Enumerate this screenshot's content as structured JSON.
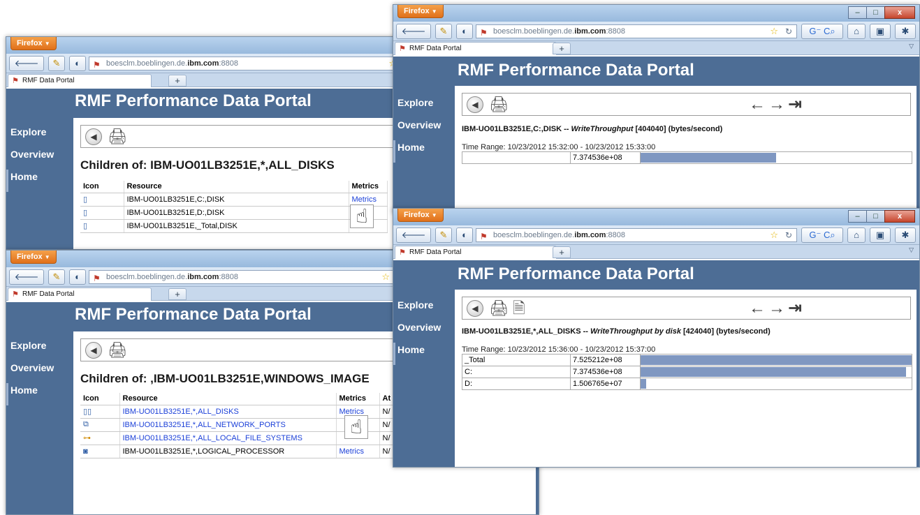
{
  "browser": {
    "menu_label": "Firefox",
    "url_host": "boesclm.boeblingen.de.",
    "url_domain": "ibm.com",
    "url_port": ":8808",
    "tab_label": "RMF Data Portal",
    "new_tab_label": "+",
    "window_controls": {
      "minimize": "–",
      "maximize": "□",
      "close": "x"
    }
  },
  "portal": {
    "title": "RMF Performance Data Portal",
    "nav": {
      "explore": "Explore",
      "overview": "Overview",
      "home": "Home"
    }
  },
  "icons": {
    "back": "back-icon",
    "print": "printer-icon",
    "export": "export-document-icon",
    "nav_arrows": "←→⇥",
    "hand_cursor": "hand-pointer-icon"
  },
  "disks_window": {
    "heading": "Children of: IBM-UO01LB3251E,*,ALL_DISKS",
    "columns": [
      "Icon",
      "Resource",
      "Metrics"
    ],
    "rows": [
      {
        "resource": "IBM-UO01LB3251E,C:,DISK",
        "metrics": "Metrics"
      },
      {
        "resource": "IBM-UO01LB3251E,D:,DISK",
        "metrics": ""
      },
      {
        "resource": "IBM-UO01LB3251E,_Total,DISK",
        "metrics": ""
      }
    ]
  },
  "image_window": {
    "heading": "Children of: ,IBM-UO01LB3251E,WINDOWS_IMAGE",
    "columns": [
      "Icon",
      "Resource",
      "Metrics",
      "At"
    ],
    "rows": [
      {
        "resource": "IBM-UO01LB3251E,*,ALL_DISKS",
        "metrics": "Metrics",
        "at": "N/"
      },
      {
        "resource": "IBM-UO01LB3251E,*,ALL_NETWORK_PORTS",
        "metrics": "",
        "at": "N/"
      },
      {
        "resource": "IBM-UO01LB3251E,*,ALL_LOCAL_FILE_SYSTEMS",
        "metrics": "",
        "at": "N/"
      },
      {
        "resource": "IBM-UO01LB3251E,*,LOGICAL_PROCESSOR",
        "metrics": "Metrics",
        "at": "N/"
      }
    ]
  },
  "metric_c_window": {
    "title_prefix": "IBM-UO01LB3251E,C:,DISK -- ",
    "metric_name": "WriteThroughput",
    "title_suffix": " [404040] (bytes/second)",
    "time_range": "Time Range: 10/23/2012 15:32:00 - 10/23/2012 15:33:00",
    "rows": [
      {
        "label": "",
        "value": "7.374536e+08",
        "fraction": 0.5
      }
    ]
  },
  "metric_all_window": {
    "title_prefix": "IBM-UO01LB3251E,*,ALL_DISKS -- ",
    "metric_name": "WriteThroughput by disk",
    "title_suffix": " [424040] (bytes/second)",
    "time_range": "Time Range: 10/23/2012 15:36:00 - 10/23/2012 15:37:00",
    "rows": [
      {
        "label": "_Total",
        "value": "7.525212e+08",
        "fraction": 1.0
      },
      {
        "label": "C:",
        "value": "7.374536e+08",
        "fraction": 0.98
      },
      {
        "label": "D:",
        "value": "1.506765e+07",
        "fraction": 0.02
      }
    ]
  }
}
